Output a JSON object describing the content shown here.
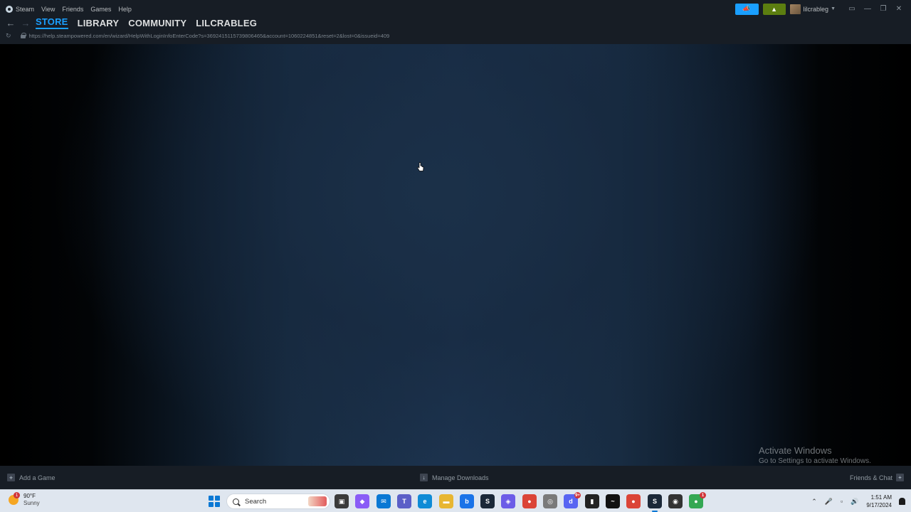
{
  "menubar": {
    "items": [
      "Steam",
      "View",
      "Friends",
      "Games",
      "Help"
    ]
  },
  "nav": {
    "back_icon": "arrow-left-icon",
    "forward_icon": "arrow-right-icon",
    "tabs": [
      "STORE",
      "LIBRARY",
      "COMMUNITY",
      "LILCRABLEG"
    ],
    "active_tab": "STORE"
  },
  "url": {
    "value": "https://help.steampowered.com/en/wizard/HelpWithLoginInfoEnterCode?s=3692415115739806465&account=1060224851&reset=2&lost=0&issueid=409"
  },
  "topright": {
    "username": "lilcrableg",
    "announce_color": "#1a9fff",
    "notif_color": "#5c7e10"
  },
  "watermark": {
    "line1": "Activate Windows",
    "line2": "Go to Settings to activate Windows."
  },
  "bottombar": {
    "add_game": "Add a Game",
    "manage_downloads": "Manage Downloads",
    "friends_chat": "Friends & Chat"
  },
  "taskbar": {
    "weather_temp": "90°F",
    "weather_cond": "Sunny",
    "weather_badge": "1",
    "search_placeholder": "Search",
    "apps": [
      {
        "name": "task-view-icon",
        "label": "▣",
        "color": "#3b3b3b"
      },
      {
        "name": "copilot-icon",
        "label": "◆",
        "color": "#8a5cf6"
      },
      {
        "name": "mail-icon",
        "label": "✉",
        "color": "#0a78d4"
      },
      {
        "name": "teams-icon",
        "label": "T",
        "color": "#5b5fc7"
      },
      {
        "name": "edge-icon",
        "label": "e",
        "color": "#0f8bd6"
      },
      {
        "name": "file-explorer-icon",
        "label": "▬",
        "color": "#e8b631"
      },
      {
        "name": "bing-icon",
        "label": "b",
        "color": "#1a73e8"
      },
      {
        "name": "steam-icon",
        "label": "S",
        "color": "#1b2838"
      },
      {
        "name": "store-icon",
        "label": "◈",
        "color": "#6c5ce7"
      },
      {
        "name": "chrome-icon",
        "label": "●",
        "color": "#db4437"
      },
      {
        "name": "overwatch-icon",
        "label": "◎",
        "color": "#7a7a7a"
      },
      {
        "name": "discord-icon",
        "label": "d",
        "color": "#5865f2",
        "badge": "9+"
      },
      {
        "name": "audio-app-icon",
        "label": "▮",
        "color": "#222"
      },
      {
        "name": "terminal-icon",
        "label": "~",
        "color": "#111"
      },
      {
        "name": "chrome-profile-icon",
        "label": "●",
        "color": "#db4437"
      },
      {
        "name": "steam-active-icon",
        "label": "S",
        "color": "#1b2838",
        "active": true
      },
      {
        "name": "obs-icon",
        "label": "◉",
        "color": "#333"
      },
      {
        "name": "chrome-alt-icon",
        "label": "●",
        "color": "#34a853",
        "badge": "1"
      }
    ],
    "time": "1:51 AM",
    "date": "9/17/2024"
  }
}
